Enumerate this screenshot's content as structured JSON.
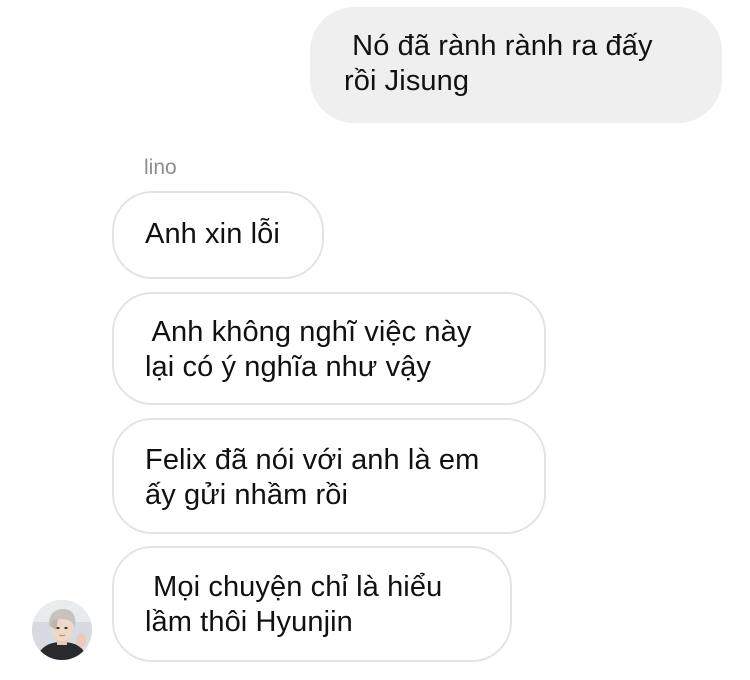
{
  "thread": {
    "sent_messages": [
      {
        "text": " Nó đã rành rành ra đấy\nrồi Jisung"
      }
    ],
    "sender_name": "lino",
    "received_messages": [
      {
        "text": "Anh xin lỗi"
      },
      {
        "text": " Anh không nghĩ việc này\nlại có ý nghĩa như vậy"
      },
      {
        "text": "Felix đã nói với anh là em\nấy gửi nhầm rồi"
      },
      {
        "text": " Mọi chuyện chỉ là hiểu\nlầm thôi Hyunjin"
      }
    ],
    "avatar_icon": "profile-photo-avatar"
  },
  "colors": {
    "sent_bubble": "#efefef",
    "received_border": "#e3e3e3",
    "sender_name": "#8e8e8e",
    "text": "#111111"
  }
}
